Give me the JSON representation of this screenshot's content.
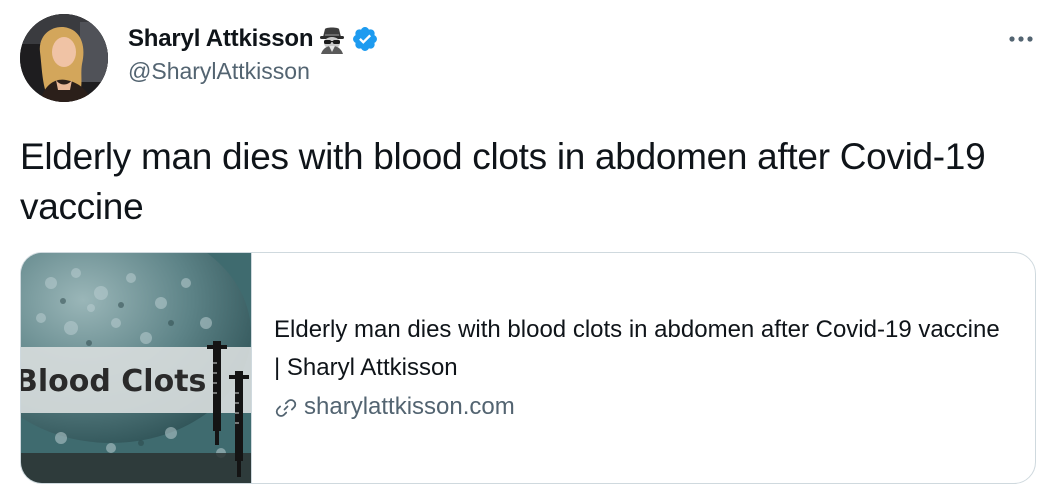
{
  "author": {
    "display_name": "Sharyl Attkisson",
    "handle": "@SharylAttkisson",
    "emoji_icon": "detective-emoji-icon",
    "verified_icon": "verified-badge-icon",
    "verified_color": "#1d9bf0"
  },
  "menu": {
    "more_icon": "more-horizontal-icon",
    "more_label": "•••"
  },
  "tweet": {
    "text": "Elderly man dies with blood clots in abdomen after Covid-19 vaccine"
  },
  "card": {
    "image_text": "Blood Clots",
    "title": "Elderly man dies with blood clots in abdomen after Covid-19 vaccine | Sharyl Attkisson",
    "domain": "sharylattkisson.com",
    "link_icon": "link-icon"
  },
  "colors": {
    "text_primary": "#0f1419",
    "text_secondary": "#536471",
    "border": "#cfd9de",
    "verified_blue": "#1d9bf0",
    "card_image_teal": "#3f6b6f"
  }
}
